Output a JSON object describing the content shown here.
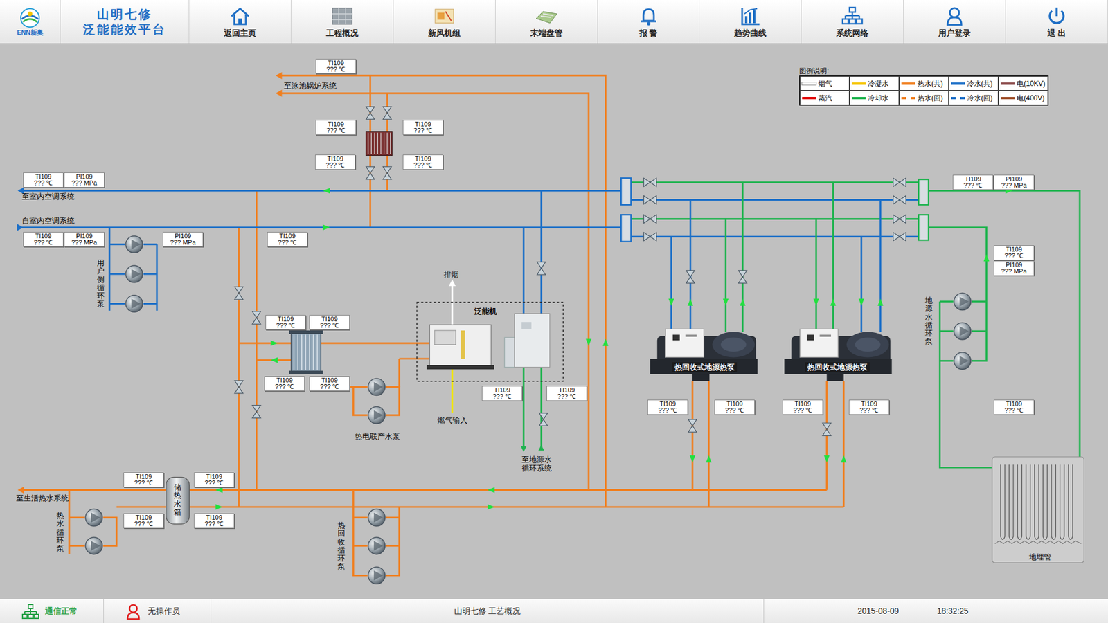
{
  "header": {
    "logo": "ENN新奥",
    "title_lines": [
      "山明七修",
      "泛能能效平台"
    ],
    "nav": [
      {
        "label": "返回主页"
      },
      {
        "label": "工程概况"
      },
      {
        "label": "新风机组"
      },
      {
        "label": "末端盘管"
      },
      {
        "label": "报 警"
      },
      {
        "label": "趋势曲线"
      },
      {
        "label": "系统网络"
      },
      {
        "label": "用户登录"
      },
      {
        "label": "退 出"
      }
    ]
  },
  "legend": {
    "title": "图例说明:",
    "items": [
      {
        "label": "烟气",
        "color": "#ffffff",
        "kind": "solid"
      },
      {
        "label": "冷凝水",
        "color": "#f5c400",
        "kind": "solid"
      },
      {
        "label": "热水(共)",
        "color": "#f07f1f",
        "kind": "solid"
      },
      {
        "label": "冷水(共)",
        "color": "#1c6fc7",
        "kind": "solid"
      },
      {
        "label": "电(10KV)",
        "color": "#8b4a4a",
        "kind": "solid"
      },
      {
        "label": "蒸汽",
        "color": "#e00000",
        "kind": "solid"
      },
      {
        "label": "冷却水",
        "color": "#1fb34f",
        "kind": "solid"
      },
      {
        "label": "热水(回)",
        "color": "#f07f1f",
        "kind": "dashed"
      },
      {
        "label": "冷水(回)",
        "color": "#1c6fc7",
        "kind": "dashed"
      },
      {
        "label": "电(400V)",
        "color": "#a0522d",
        "kind": "solid"
      }
    ]
  },
  "sensors": [
    {
      "tag": "TI109",
      "value": "??? ℃"
    },
    {
      "tag": "TI109",
      "value": "??? ℃"
    },
    {
      "tag": "TI109",
      "value": "??? ℃"
    },
    {
      "tag": "TI109",
      "value": "??? ℃"
    },
    {
      "tag": "TI109",
      "value": "??? ℃"
    },
    {
      "tag": "TI109",
      "value": "??? ℃"
    },
    {
      "tag": "PI109",
      "value": "??? MPa"
    },
    {
      "tag": "TI109",
      "value": "??? ℃"
    },
    {
      "tag": "PI109",
      "value": "??? MPa"
    },
    {
      "tag": "PI109",
      "value": "??? MPa"
    },
    {
      "tag": "TI109",
      "value": "??? ℃"
    },
    {
      "tag": "TI109",
      "value": "??? ℃"
    },
    {
      "tag": "TI109",
      "value": "??? ℃"
    },
    {
      "tag": "TI109",
      "value": "??? ℃"
    },
    {
      "tag": "TI109",
      "value": "??? ℃"
    },
    {
      "tag": "TI109",
      "value": "??? ℃"
    },
    {
      "tag": "TI109",
      "value": "??? ℃"
    },
    {
      "tag": "TI109",
      "value": "??? ℃"
    },
    {
      "tag": "PI109",
      "value": "??? MPa"
    },
    {
      "tag": "TI109",
      "value": "??? ℃"
    },
    {
      "tag": "PI109",
      "value": "??? MPa"
    },
    {
      "tag": "TI109",
      "value": "??? ℃"
    },
    {
      "tag": "TI109",
      "value": "??? ℃"
    },
    {
      "tag": "TI109",
      "value": "??? ℃"
    },
    {
      "tag": "TI109",
      "value": "??? ℃"
    },
    {
      "tag": "TI109",
      "value": "??? ℃"
    },
    {
      "tag": "TI109",
      "value": "??? ℃"
    },
    {
      "tag": "TI109",
      "value": "??? ℃"
    },
    {
      "tag": "TI109",
      "value": "??? ℃"
    },
    {
      "tag": "TI109",
      "value": "??? ℃"
    }
  ],
  "labels": [
    {
      "text": "至泳池锅炉系统",
      "kind": "plain"
    },
    {
      "text": "至室内空调系统",
      "kind": "plain"
    },
    {
      "text": "自室内空调系统",
      "kind": "plain"
    },
    {
      "text": "排烟",
      "kind": "plain"
    },
    {
      "text": "泛能机",
      "kind": "plain"
    },
    {
      "text": "燃气输入",
      "kind": "plain"
    },
    {
      "text": "热电联产水泵",
      "kind": "plain"
    },
    {
      "text": "至地源水循环系统",
      "kind": "wrap"
    },
    {
      "text": "至生活热水系统",
      "kind": "plain"
    },
    {
      "text": "地埋管",
      "kind": "plain"
    },
    {
      "text": "热回收式地源热泵",
      "kind": "banner"
    },
    {
      "text": "热回收式地源热泵",
      "kind": "banner"
    },
    {
      "text": "用户侧循环泵",
      "kind": "vertical"
    },
    {
      "text": "地源水循环泵",
      "kind": "vertical"
    },
    {
      "text": "热水循环泵",
      "kind": "vertical"
    },
    {
      "text": "热回收循环泵",
      "kind": "vertical"
    },
    {
      "text": "储热水箱",
      "kind": "vertical"
    }
  ],
  "status_bar": {
    "comm": "通信正常",
    "operator": "无操作员",
    "page": "山明七修 工艺概况",
    "date": "2015-08-09",
    "time": "18:32:25"
  }
}
